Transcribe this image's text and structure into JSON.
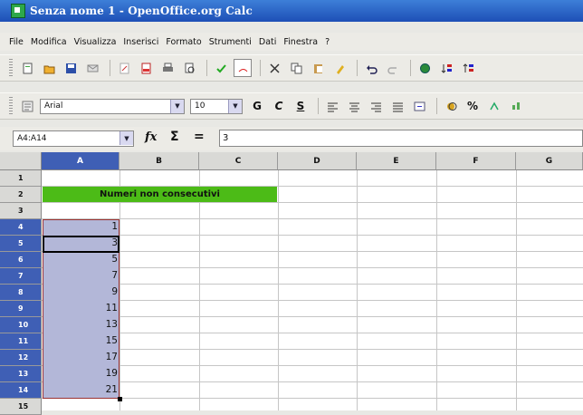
{
  "window": {
    "title": "Senza nome 1 - OpenOffice.org Calc"
  },
  "menu": [
    "File",
    "Modifica",
    "Visualizza",
    "Inserisci",
    "Formato",
    "Strumenti",
    "Dati",
    "Finestra",
    "?"
  ],
  "format_toolbar": {
    "font_name": "Arial",
    "font_size": "10",
    "bold_label": "G",
    "italic_label": "C",
    "underline_label": "S",
    "percent_label": "%"
  },
  "formula_bar": {
    "name_box": "A4:A14",
    "fx_label": "fx",
    "sigma_label": "Σ",
    "equals_label": "=",
    "input_value": "3"
  },
  "columns": [
    "A",
    "B",
    "C",
    "D",
    "E",
    "F",
    "G"
  ],
  "rows": [
    "1",
    "2",
    "3",
    "4",
    "5",
    "6",
    "7",
    "8",
    "9",
    "10",
    "11",
    "12",
    "13",
    "14",
    "15"
  ],
  "cells": {
    "banner": "Numeri non consecutivi",
    "column_a_values": [
      "1",
      "3",
      "5",
      "7",
      "9",
      "11",
      "13",
      "15",
      "17",
      "19",
      "21"
    ]
  },
  "colors": {
    "title_bar": "#1d4fb6",
    "banner_green": "#4cbb17",
    "selection": "#b3b7d8",
    "selected_header": "#3f5fb5"
  }
}
